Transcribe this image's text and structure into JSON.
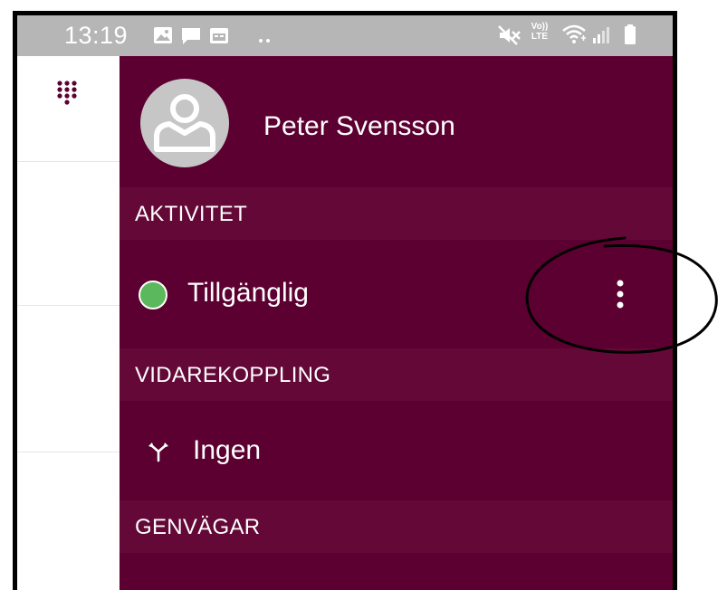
{
  "status_bar": {
    "time": "13:19",
    "left_icons": [
      "image-icon",
      "message-icon",
      "calendar-icon",
      "more-notifications-icon"
    ],
    "right_icons": [
      "mute-icon",
      "volte-icon",
      "wifi-icon",
      "signal-icon",
      "battery-icon"
    ],
    "volte_label_top": "Vo))",
    "volte_label_bottom": "LTE"
  },
  "background_app": {
    "icons": [
      "dialpad-icon"
    ]
  },
  "drawer": {
    "user": {
      "name": "Peter Svensson"
    },
    "sections": {
      "activity": {
        "header": "AKTIVITET",
        "status_label": "Tillgänglig",
        "status_color": "#5cb85c"
      },
      "forwarding": {
        "header": "VIDAREKOPPLING",
        "value_label": "Ingen"
      },
      "shortcuts": {
        "header": "GENVÄGAR"
      }
    },
    "colors": {
      "background": "#5b0030",
      "section_header": "#630837",
      "accent": "#6a0c3c"
    }
  }
}
